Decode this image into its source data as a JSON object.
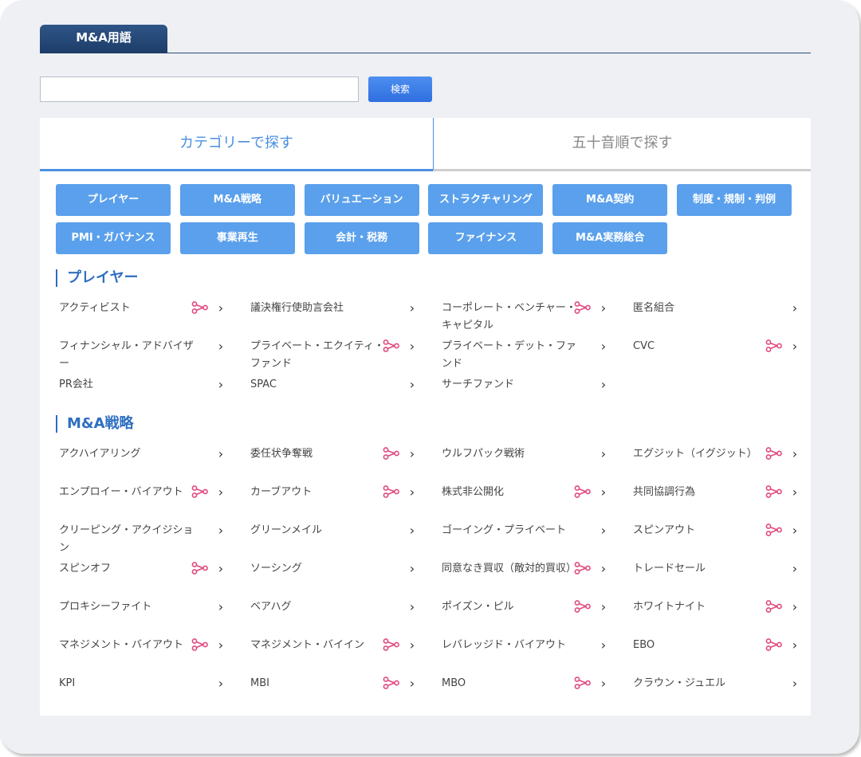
{
  "header": {
    "title": "M&A用語"
  },
  "search": {
    "placeholder": "",
    "button_label": "検索"
  },
  "tabs": {
    "category": "カテゴリーで探す",
    "kana": "五十音順で探す"
  },
  "categories": [
    "プレイヤー",
    "M&A戦略",
    "バリュエーション",
    "ストラクチャリング",
    "M&A契約",
    "制度・規制・判例",
    "PMI・ガバナンス",
    "事業再生",
    "会計・税務",
    "ファイナンス",
    "M&A実務総合"
  ],
  "colors": {
    "accent": "#4a8fe0",
    "chip": "#5aa0ec",
    "header": "#1d3d68",
    "relation_icon": "#e0497f"
  },
  "sections": [
    {
      "title": "プレイヤー",
      "terms": [
        {
          "label": "アクティビスト",
          "icon": true
        },
        {
          "label": "議決権行使助言会社",
          "icon": false
        },
        {
          "label": "コーポレート・ベンチャー・キャピタル",
          "icon": true
        },
        {
          "label": "匿名組合",
          "icon": false
        },
        {
          "label": "フィナンシャル・アドバイザー",
          "icon": false
        },
        {
          "label": "プライベート・エクイティ・ファンド",
          "icon": true
        },
        {
          "label": "プライベート・デット・ファンド",
          "icon": false
        },
        {
          "label": "CVC",
          "icon": true
        },
        {
          "label": "PR会社",
          "icon": false
        },
        {
          "label": "SPAC",
          "icon": false
        },
        {
          "label": "サーチファンド",
          "icon": false
        }
      ]
    },
    {
      "title": "M&A戦略",
      "terms": [
        {
          "label": "アクハイアリング",
          "icon": false
        },
        {
          "label": "委任状争奪戦",
          "icon": true
        },
        {
          "label": "ウルフパック戦術",
          "icon": false
        },
        {
          "label": "エグジット（イグジット）",
          "icon": true
        },
        {
          "label": "エンプロイー・バイアウト",
          "icon": true
        },
        {
          "label": "カーブアウト",
          "icon": true
        },
        {
          "label": "株式非公開化",
          "icon": true
        },
        {
          "label": "共同協調行為",
          "icon": true
        },
        {
          "label": "クリーピング・アクイジション",
          "icon": false
        },
        {
          "label": "グリーンメイル",
          "icon": false
        },
        {
          "label": "ゴーイング・プライベート",
          "icon": false
        },
        {
          "label": "スピンアウト",
          "icon": true
        },
        {
          "label": "スピンオフ",
          "icon": true
        },
        {
          "label": "ソーシング",
          "icon": false
        },
        {
          "label": "同意なき買収（敵対的買収）",
          "icon": true
        },
        {
          "label": "トレードセール",
          "icon": false
        },
        {
          "label": "プロキシーファイト",
          "icon": false
        },
        {
          "label": "ベアハグ",
          "icon": false
        },
        {
          "label": "ポイズン・ピル",
          "icon": true
        },
        {
          "label": "ホワイトナイト",
          "icon": true
        },
        {
          "label": "マネジメント・バイアウト",
          "icon": true
        },
        {
          "label": "マネジメント・バイイン",
          "icon": true
        },
        {
          "label": "レバレッジド・バイアウト",
          "icon": false
        },
        {
          "label": "EBO",
          "icon": true
        },
        {
          "label": "KPI",
          "icon": false
        },
        {
          "label": "MBI",
          "icon": true
        },
        {
          "label": "MBO",
          "icon": true
        },
        {
          "label": "クラウン・ジュエル",
          "icon": false
        }
      ]
    }
  ]
}
